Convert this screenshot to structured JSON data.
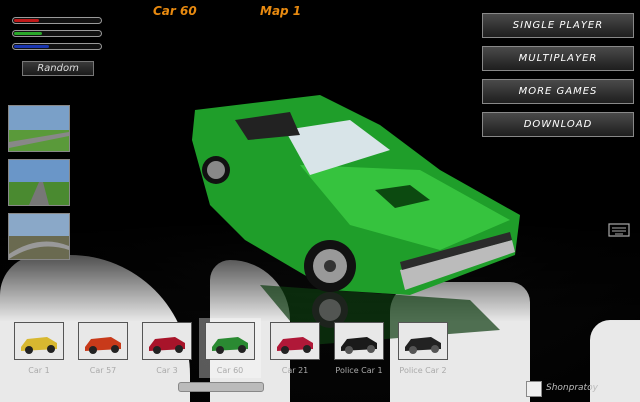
{
  "header": {
    "car_label": "Car 60",
    "map_label": "Map 1"
  },
  "sliders": {
    "red": 0.28,
    "green": 0.32,
    "blue": 0.4
  },
  "random_button": "Random",
  "menu": [
    "SINGLE PLAYER",
    "MULTIPLAYER",
    "MORE GAMES",
    "DOWNLOAD"
  ],
  "cars": [
    {
      "label": "Car 1",
      "color": "#d8b830"
    },
    {
      "label": "Car 57",
      "color": "#c83a1a"
    },
    {
      "label": "Car 3",
      "color": "#a8142a"
    },
    {
      "label": "Car 60",
      "color": "#2a8a32",
      "selected": true
    },
    {
      "label": "Car 21",
      "color": "#b01838"
    },
    {
      "label": "Police Car 1",
      "color": "#1a1a1a"
    },
    {
      "label": "Police Car 2",
      "color": "#222222"
    }
  ],
  "credit": "Shonpratoy",
  "colors": {
    "accent": "#e88a10",
    "car_body": "#1f9e2a"
  }
}
